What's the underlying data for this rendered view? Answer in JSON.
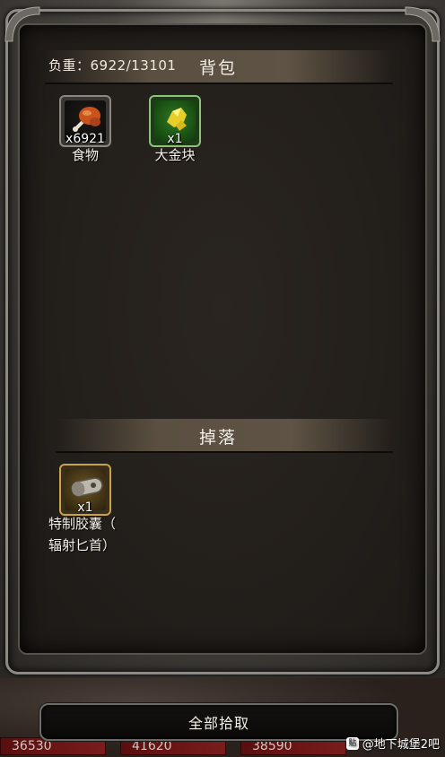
{
  "bag": {
    "weight_text": "负重：6922/13101",
    "title": "背包",
    "items": [
      {
        "name": "食物",
        "qty": "x6921",
        "icon": "meat-icon"
      },
      {
        "name": "大金块",
        "qty": "x1",
        "icon": "gold-nugget-icon"
      }
    ]
  },
  "drops": {
    "title": "掉落",
    "items": [
      {
        "name_line1": "特制胶囊（",
        "name_line2": "辐射匕首）",
        "qty": "x1",
        "icon": "capsule-icon"
      }
    ]
  },
  "actions": {
    "pickup_all": "全部拾取"
  },
  "background": {
    "hp_values": [
      "36530",
      "41620",
      "38590"
    ]
  },
  "watermark": {
    "text": "@地下城堡2吧"
  },
  "colors": {
    "rare_green": "#1f6a1a",
    "epic_gold": "#b8902e",
    "hp_red": "#7a1c1c"
  }
}
